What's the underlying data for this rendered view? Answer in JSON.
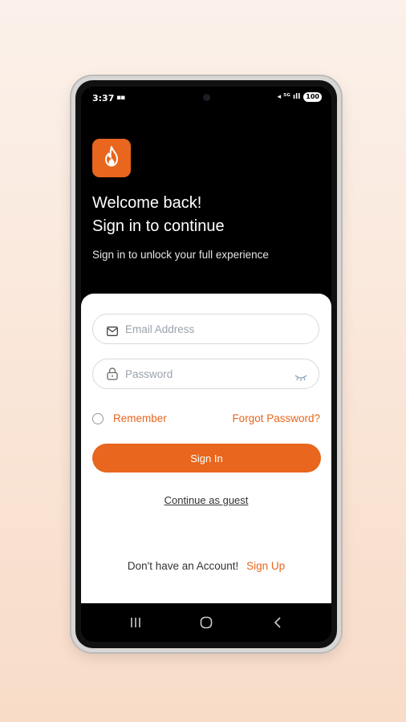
{
  "status": {
    "time": "3:37",
    "grid_glyph": "▪▪",
    "signal_icons": "◂ ⁵ᴳ ıll",
    "battery": "100"
  },
  "header": {
    "logo_icon": "flame-icon",
    "welcome_line1": "Welcome back!",
    "welcome_line2": "Sign in to continue",
    "subtitle": "Sign in to unlock your full experience"
  },
  "form": {
    "email_placeholder": "Email Address",
    "password_placeholder": "Password",
    "remember_label": "Remember",
    "forgot_label": "Forgot Password?",
    "signin_label": "Sign In",
    "guest_label": "Continue as guest",
    "no_account_text": "Don't have an Account!",
    "signup_label": "Sign Up"
  },
  "colors": {
    "accent": "#e8661d",
    "background": "#000000",
    "card": "#ffffff"
  },
  "navbar": {
    "recents_icon": "recents-icon",
    "home_icon": "home-icon",
    "back_icon": "back-icon"
  }
}
